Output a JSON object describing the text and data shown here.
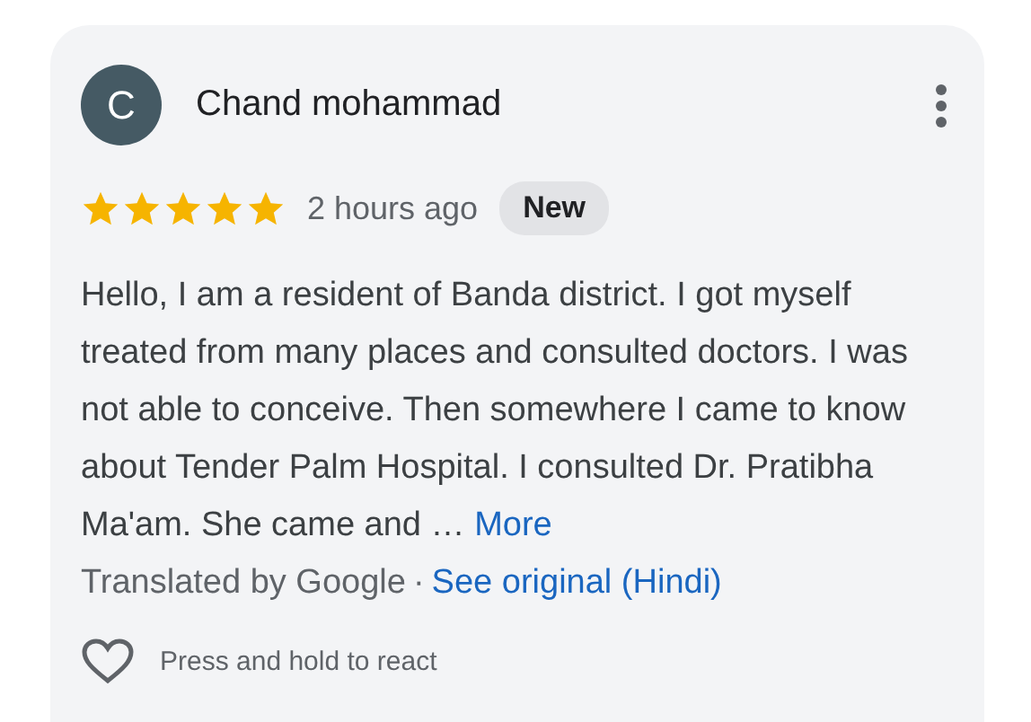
{
  "review": {
    "avatar_letter": "C",
    "author": "Chand mohammad",
    "stars": 5,
    "time": "2 hours ago",
    "badge": "New",
    "text": "Hello, I am a resident of Banda district. I got myself treated from many places and consulted doctors. I was not able to conceive. Then somewhere I came to know about Tender Palm Hospital. I consulted Dr. Pratibha Ma'am. She came and …",
    "more_link": "More",
    "translation_note": "Translated by Google",
    "separator": "·",
    "original_link": "See original (Hindi)",
    "react_hint": "Press and hold to react"
  }
}
